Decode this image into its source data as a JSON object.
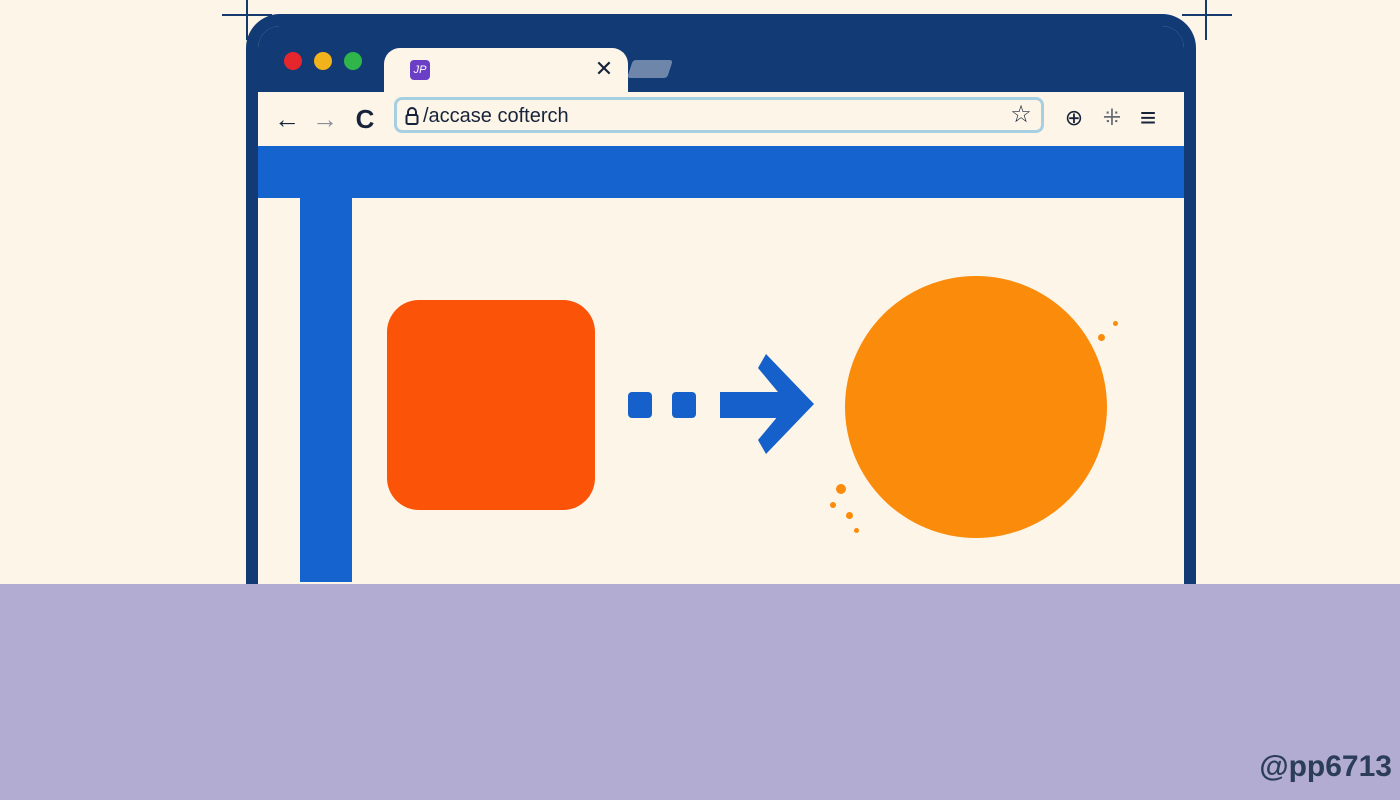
{
  "browser": {
    "tab": {
      "favicon_text": "JP",
      "close_glyph": "✕"
    },
    "toolbar": {
      "back_glyph": "←",
      "forward_glyph": "→",
      "reload_glyph": "C",
      "url": "/accase cofterch",
      "star_glyph": "☆",
      "globe_glyph": "⊕",
      "extensions_glyph": "⁜",
      "menu_glyph": "≡"
    }
  },
  "illustration": {
    "square_color": "#fb5307",
    "circle_color": "#fa8b0b",
    "arrow_color": "#1560cb",
    "stripe_color": "#1463cf",
    "frame_color": "#123a74",
    "ground_color": "#b2abd2",
    "background_color": "#fdf5e8"
  },
  "watermark": "@pp6713"
}
